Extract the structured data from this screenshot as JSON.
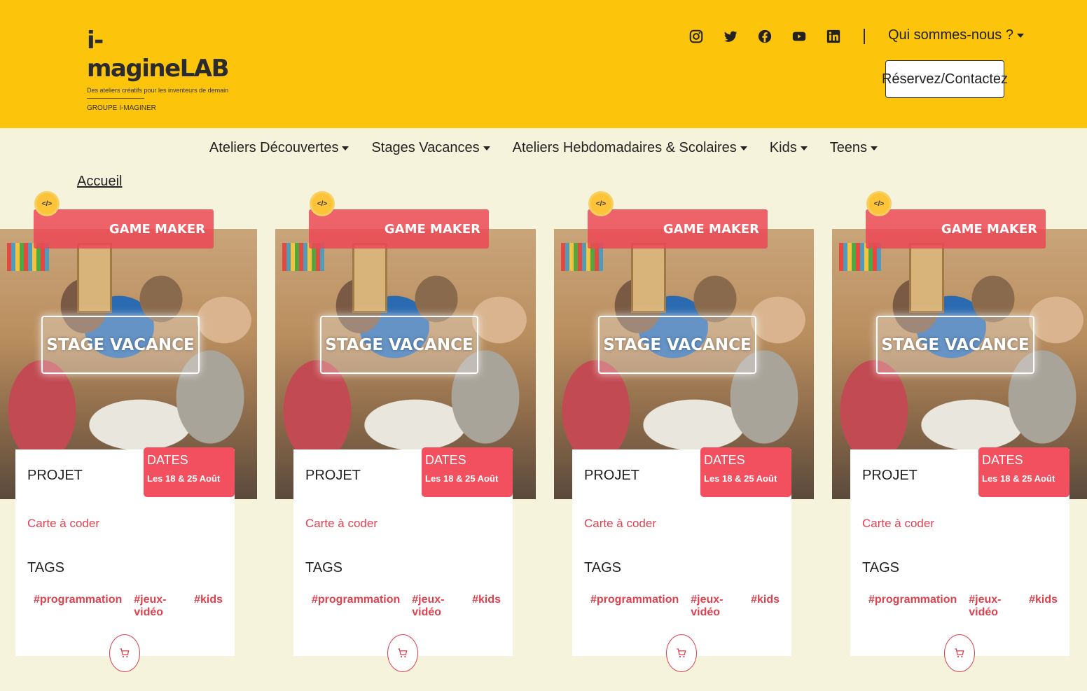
{
  "brand": {
    "name": "i-magineLAB",
    "tagline": "Des ateliers créatifs pour les inventeurs de demain",
    "group": "GROUPE I-MAGINER",
    "accent": "#fdc40c",
    "red": "#e0414f"
  },
  "header": {
    "social_icons": [
      "instagram-icon",
      "twitter-icon",
      "facebook-icon",
      "youtube-icon",
      "linkedin-icon"
    ],
    "about_label": "Qui sommes-nous ?",
    "contact_label": "Réservez/Contactez"
  },
  "nav": {
    "items": [
      {
        "label": "Ateliers Découvertes"
      },
      {
        "label": "Stages Vacances"
      },
      {
        "label": "Ateliers Hebdomadaires & Scolaires"
      },
      {
        "label": "Kids"
      },
      {
        "label": "Teens"
      }
    ]
  },
  "breadcrumb": {
    "label": "Accueil"
  },
  "cards": [
    {
      "ribbon": "GAME MAKER",
      "badge": "</>",
      "overlay": "STAGE VACANCE",
      "projet_label": "PROJET",
      "dates_label": "DATES",
      "dates_value": "Les 18 & 25 Août",
      "projet_link": "Carte à coder",
      "tags_label": "TAGS",
      "tags": [
        "#programmation",
        "#jeux-vidéo",
        "#kids"
      ]
    },
    {
      "ribbon": "GAME MAKER",
      "badge": "</>",
      "overlay": "STAGE VACANCE",
      "projet_label": "PROJET",
      "dates_label": "DATES",
      "dates_value": "Les 18 & 25 Août",
      "projet_link": "Carte à coder",
      "tags_label": "TAGS",
      "tags": [
        "#programmation",
        "#jeux-vidéo",
        "#kids"
      ]
    },
    {
      "ribbon": "GAME MAKER",
      "badge": "</>",
      "overlay": "STAGE VACANCE",
      "projet_label": "PROJET",
      "dates_label": "DATES",
      "dates_value": "Les 18 & 25 Août",
      "projet_link": "Carte à coder",
      "tags_label": "TAGS",
      "tags": [
        "#programmation",
        "#jeux-vidéo",
        "#kids"
      ]
    },
    {
      "ribbon": "GAME MAKER",
      "badge": "</>",
      "overlay": "STAGE VACANCE",
      "projet_label": "PROJET",
      "dates_label": "DATES",
      "dates_value": "Les 18 & 25 Août",
      "projet_link": "Carte à coder",
      "tags_label": "TAGS",
      "tags": [
        "#programmation",
        "#jeux-vidéo",
        "#kids"
      ]
    }
  ]
}
